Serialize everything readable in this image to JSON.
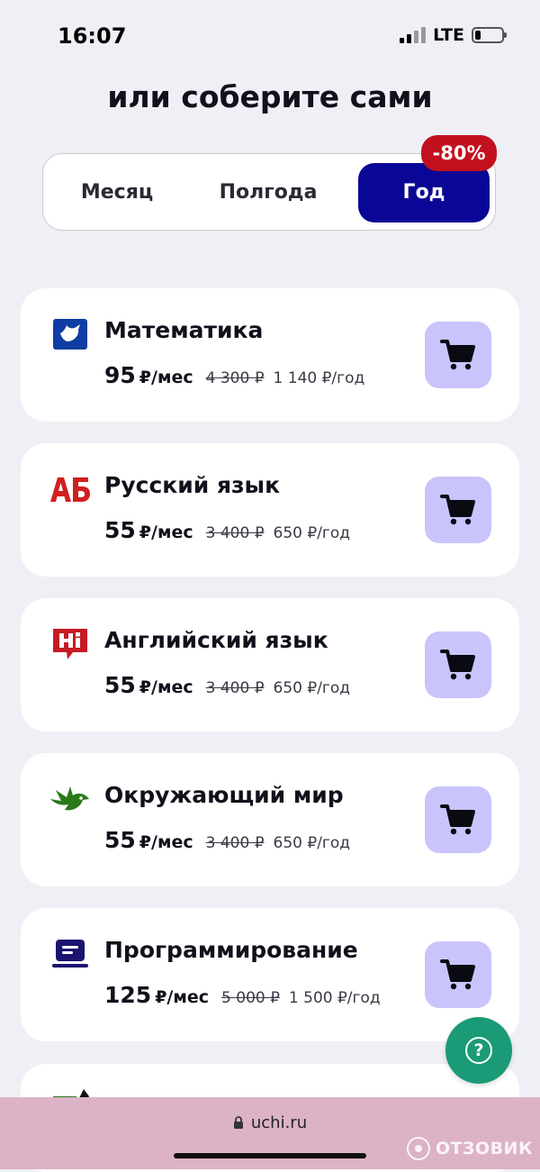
{
  "status_bar": {
    "time": "16:07",
    "network": "LTE"
  },
  "heading": "или соберите сами",
  "period_tabs": [
    {
      "label": "Месяц",
      "selected": false
    },
    {
      "label": "Полгода",
      "selected": false
    },
    {
      "label": "Год",
      "selected": true
    }
  ],
  "discount_badge": "-80%",
  "subjects": [
    {
      "name": "Математика",
      "price": "95",
      "unit": "₽/мес",
      "old_price": "4 300 ₽",
      "year_price": "1 140 ₽/год",
      "icon": "math-bird-icon"
    },
    {
      "name": "Русский язык",
      "price": "55",
      "unit": "₽/мес",
      "old_price": "3 400 ₽",
      "year_price": "650 ₽/год",
      "icon": "russian-ab-icon"
    },
    {
      "name": "Английский язык",
      "price": "55",
      "unit": "₽/мес",
      "old_price": "3 400 ₽",
      "year_price": "650 ₽/год",
      "icon": "english-hi-icon"
    },
    {
      "name": "Окружающий мир",
      "price": "55",
      "unit": "₽/мес",
      "old_price": "3 400 ₽",
      "year_price": "650 ₽/год",
      "icon": "world-bird-icon"
    },
    {
      "name": "Программирование",
      "price": "125",
      "unit": "₽/мес",
      "old_price": "5 000 ₽",
      "year_price": "1 500 ₽/год",
      "icon": "programming-laptop-icon"
    }
  ],
  "help_button": {
    "label": "?"
  },
  "browser": {
    "url": "uchi.ru"
  },
  "watermark": "ОТЗОВИК",
  "colors": {
    "accent": "#0b0796",
    "badge": "#c3101e",
    "cart_bg": "#c9c4fb",
    "help": "#1a9a76"
  }
}
